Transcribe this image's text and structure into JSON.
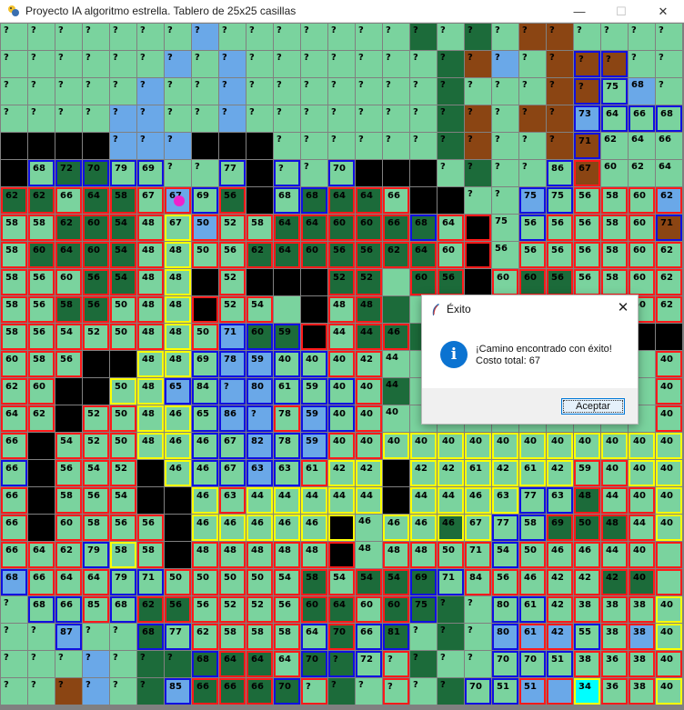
{
  "window": {
    "title": "Proyecto IA algoritmo estrella. Tablero de 25x25 casillas",
    "minimize_glyph": "—",
    "maximize_glyph": "☐",
    "close_glyph": "✕"
  },
  "board": {
    "size": 25,
    "legend_codes": {
      "L": "light-green",
      "D": "dark-green",
      "W": "water-blue",
      "B": "brown",
      "K": "black",
      "C": "cyan"
    },
    "colors": {
      "L": "#7ad39e",
      "D": "#1c6b3a",
      "W": "#6aa8e8",
      "B": "#8b4513",
      "K": "#000000",
      "C": "#00ffff"
    },
    "border_colors": {
      "R": "#ff1a1a",
      "U": "#1010e0",
      "Y": "#ffff00"
    },
    "terrain": [
      "LLLLLLLWLLLLLLLDLDLBBLLLL",
      "LLLLLLWLWLLLLLLLDBWLBBBLL",
      "LLLLLWLLWLLLLLLLDLLLBBLWL",
      "LLLLWWLLWLLLLLLLDBLBBWLLL",
      "KKKKWWWKKKLLLLLLDBLLBBLLL",
      "KLDDLLLLLKLLLKKKLDLLLBLLL",
      "DDLDDLWLDKLDDDLKKLLWLLLLW",
      "LLDDDLLWLLDDDDDDLKLLLLLLB",
      "LDDDDLLLLDDDDDDDLKLLLLLLL",
      "LLLDDLLKLKKKDDLDDKLDDLLLL",
      "LLDDLLLKLLLKLDDLLLLLLLLLL",
      "LLLLLLLLWDDKLDDDLLLLLLLKK",
      "LLLKKLLLWWLLLLLLLLLLLLLLL",
      "LLKKLLWLWWLLLLDLLLLLLLLLL",
      "LLKLLLLLWWLWLLLLLLLLLLLLL",
      "LKLLLLLLLWLWLLLLLLLLLLLLL",
      "LKLLLKLLLWLLLLKLLLLLLLLLL",
      "LKLLLKKLLLLLLLKLLLLLLDLLL",
      "LKLLLLKLLLLLKLLLDLLLDDDLL",
      "LLLLLLKLLLLLKLLLLLLLLLLLL",
      "WLLLLLLLLLLDLDDDLLLLLLDDL",
      "LLLLLDDLLLLDDLDDDLLLLLLLL",
      "LLWLLDLLLLLLDLDLDLWWWLLWL",
      "LLLWLDDDDDLDDLLDLLLLLLLLL",
      "LLBWLDWDDDDLDLLLDLLWWCLLL"
    ],
    "labels": [
      [
        "?",
        "?",
        "?",
        "?",
        "?",
        "?",
        "?",
        "?",
        "?",
        "?",
        "?",
        "?",
        "?",
        "?",
        "?",
        "?",
        "?",
        "?",
        "?",
        "?",
        "?",
        "?",
        "?",
        "?",
        "?"
      ],
      [
        "?",
        "?",
        "?",
        "?",
        "?",
        "?",
        "?",
        "?",
        "?",
        "?",
        "?",
        "?",
        "?",
        "?",
        "?",
        "?",
        "?",
        "?",
        "?",
        "?",
        "?",
        "?",
        "?",
        "?",
        "?"
      ],
      [
        "?",
        "?",
        "?",
        "?",
        "?",
        "?",
        "?",
        "?",
        "?",
        "?",
        "?",
        "?",
        "?",
        "?",
        "?",
        "?",
        "?",
        "?",
        "?",
        "?",
        "?",
        "?",
        "75",
        "68",
        "?"
      ],
      [
        "?",
        "?",
        "?",
        "?",
        "?",
        "?",
        "?",
        "?",
        "?",
        "?",
        "?",
        "?",
        "?",
        "?",
        "?",
        "?",
        "?",
        "?",
        "?",
        "?",
        "?",
        "73",
        "64",
        "66",
        "68"
      ],
      [
        "",
        "",
        "",
        "",
        "?",
        "?",
        "?",
        "",
        "",
        "",
        "?",
        "?",
        "?",
        "?",
        "?",
        "?",
        "?",
        "?",
        "?",
        "?",
        "?",
        "71",
        "62",
        "64",
        "66"
      ],
      [
        "",
        "68",
        "72",
        "70",
        "79",
        "69",
        "?",
        "?",
        "77",
        "",
        "?",
        "?",
        "70",
        "",
        "",
        "",
        "?",
        "?",
        "?",
        "?",
        "86",
        "67",
        "60",
        "62",
        "64"
      ],
      [
        "62",
        "62",
        "66",
        "64",
        "58",
        "67",
        "67",
        "69",
        "56",
        "",
        "68",
        "68",
        "64",
        "64",
        "66",
        "",
        "",
        "?",
        "?",
        "75",
        "75",
        "56",
        "58",
        "60",
        "62"
      ],
      [
        "58",
        "58",
        "62",
        "60",
        "54",
        "48",
        "67",
        "50",
        "52",
        "58",
        "64",
        "64",
        "60",
        "60",
        "66",
        "68",
        "64",
        "",
        "75",
        "56",
        "56",
        "56",
        "58",
        "60",
        "71"
      ],
      [
        "58",
        "60",
        "64",
        "60",
        "54",
        "48",
        "48",
        "50",
        "56",
        "62",
        "64",
        "60",
        "56",
        "56",
        "62",
        "64",
        "60",
        "",
        "56",
        "56",
        "56",
        "56",
        "58",
        "60",
        "62"
      ],
      [
        "58",
        "56",
        "60",
        "56",
        "54",
        "48",
        "48",
        "",
        "52",
        "",
        "",
        "",
        "52",
        "52",
        "",
        "60",
        "56",
        "",
        "60",
        "60",
        "56",
        "56",
        "58",
        "60",
        "62"
      ],
      [
        "58",
        "56",
        "58",
        "56",
        "50",
        "48",
        "48",
        "50",
        "52",
        "54",
        "",
        "",
        "48",
        "48",
        "",
        "",
        "",
        "",
        "",
        "",
        "",
        "",
        "",
        "60",
        "62"
      ],
      [
        "58",
        "56",
        "54",
        "52",
        "50",
        "48",
        "48",
        "50",
        "71",
        "60",
        "59",
        "40",
        "44",
        "44",
        "46",
        "",
        "",
        "",
        "",
        "",
        "",
        "",
        "",
        "",
        ""
      ],
      [
        "60",
        "58",
        "56",
        "",
        "",
        "48",
        "48",
        "69",
        "78",
        "59",
        "40",
        "40",
        "40",
        "42",
        "44",
        "",
        "",
        "",
        "",
        "",
        "",
        "",
        "",
        "",
        "40"
      ],
      [
        "62",
        "60",
        "",
        "",
        "50",
        "48",
        "65",
        "84",
        "?",
        "80",
        "61",
        "59",
        "40",
        "40",
        "44",
        "",
        "",
        "",
        "",
        "",
        "",
        "",
        "",
        "",
        "40"
      ],
      [
        "64",
        "62",
        "",
        "52",
        "50",
        "48",
        "46",
        "65",
        "86",
        "?",
        "78",
        "59",
        "40",
        "40",
        "40",
        "",
        "",
        "",
        "",
        "",
        "",
        "",
        "",
        "",
        "40"
      ],
      [
        "66",
        "",
        "54",
        "52",
        "50",
        "48",
        "46",
        "46",
        "67",
        "82",
        "78",
        "59",
        "40",
        "40",
        "40",
        "40",
        "40",
        "40",
        "40",
        "40",
        "40",
        "40",
        "40",
        "40",
        "40"
      ],
      [
        "66",
        "",
        "56",
        "54",
        "52",
        "",
        "46",
        "46",
        "67",
        "63",
        "63",
        "61",
        "42",
        "42",
        "",
        "42",
        "42",
        "61",
        "42",
        "61",
        "42",
        "59",
        "40",
        "40",
        "40"
      ],
      [
        "66",
        "",
        "58",
        "56",
        "54",
        "",
        "",
        "46",
        "63",
        "44",
        "44",
        "44",
        "44",
        "44",
        "",
        "44",
        "44",
        "46",
        "63",
        "77",
        "63",
        "48",
        "44",
        "40",
        "40"
      ],
      [
        "66",
        "",
        "60",
        "58",
        "56",
        "56",
        "",
        "46",
        "46",
        "46",
        "46",
        "46",
        "",
        "46",
        "46",
        "46",
        "46",
        "67",
        "77",
        "58",
        "69",
        "50",
        "48",
        "44",
        "40"
      ],
      [
        "66",
        "64",
        "62",
        "79",
        "58",
        "58",
        "",
        "48",
        "48",
        "48",
        "48",
        "48",
        "",
        "48",
        "48",
        "48",
        "50",
        "71",
        "54",
        "50",
        "46",
        "46",
        "44",
        "40",
        ""
      ],
      [
        "68",
        "66",
        "64",
        "64",
        "79",
        "71",
        "50",
        "50",
        "50",
        "50",
        "54",
        "58",
        "54",
        "54",
        "54",
        "69",
        "71",
        "84",
        "56",
        "46",
        "42",
        "42",
        "42",
        "40",
        ""
      ],
      [
        "?",
        "68",
        "66",
        "85",
        "68",
        "62",
        "56",
        "56",
        "52",
        "52",
        "56",
        "60",
        "64",
        "60",
        "60",
        "75",
        "?",
        "?",
        "80",
        "61",
        "42",
        "38",
        "38",
        "38",
        "40"
      ],
      [
        "?",
        "?",
        "87",
        "?",
        "?",
        "68",
        "77",
        "62",
        "58",
        "58",
        "58",
        "64",
        "70",
        "66",
        "81",
        "?",
        "?",
        "?",
        "80",
        "61",
        "42",
        "55",
        "38",
        "38",
        "40"
      ],
      [
        "?",
        "?",
        "?",
        "?",
        "?",
        "?",
        "?",
        "68",
        "64",
        "64",
        "64",
        "70",
        "?",
        "72",
        "?",
        "?",
        "?",
        "?",
        "70",
        "70",
        "51",
        "38",
        "36",
        "38",
        "40"
      ],
      [
        "?",
        "?",
        "?",
        "?",
        "?",
        "?",
        "85",
        "66",
        "66",
        "66",
        "70",
        "?",
        "?",
        "?",
        "?",
        "?",
        "?",
        "70",
        "51",
        "51",
        "",
        "34",
        "36",
        "38",
        "40"
      ]
    ],
    "borders": [
      "-------------------------",
      "---------------------UU--",
      "---------------------UU--",
      "---------------------UUUU",
      "---------------------U---",
      "-UUUUU--U-U-U-------UR---",
      "RRRRRRRUR-UURRR----UURRRR",
      "RRRRRRYRRRRRRRRURR-URRRRU",
      "RRRRRRYRRRRRRRRRRR-RRRRRR",
      "RRRRRRY-R---RR-RR-RRRRRRR",
      "RRRRRRYRRR--RR---------RR",
      "RRRRRRYRUUURRRR----------",
      "RRR--YYUUUUURR----------R",
      "RR--YYUUUUUUUR----------R",
      "RR-RRYYUUURUUR----------R",
      "R-RRRYYUUUUURRYYYYYYYYYYY",
      "U-RRR-YUUUURYY-YYYYYYRRYY",
      "R-RRR--YRYYYYY-YYYYUURRRY",
      "R-RRRR-YYYYYY-YYYYUURRRRY",
      "RRRUYR-RRRRRR-RRRRURRRRRR",
      "URRRUURRRRRRRRRUURRRRRRRR",
      "-UURURRRRRRRRRRU--UURRRRY",
      "--U--UURRRRURUU---URRURRY",
      "-------URRRUUUR---UUURRRR",
      "------URRRUR--R--UURRYRRY"
    ],
    "agent_marker": {
      "row": 6,
      "col": 6,
      "color": "#ee22cc"
    }
  },
  "dialog": {
    "title": "Éxito",
    "close_glyph": "✕",
    "info_glyph": "i",
    "message_line1": "¡Camino encontrado con éxito!",
    "message_line2": "Costo total: 67",
    "ok_label": "Aceptar"
  }
}
